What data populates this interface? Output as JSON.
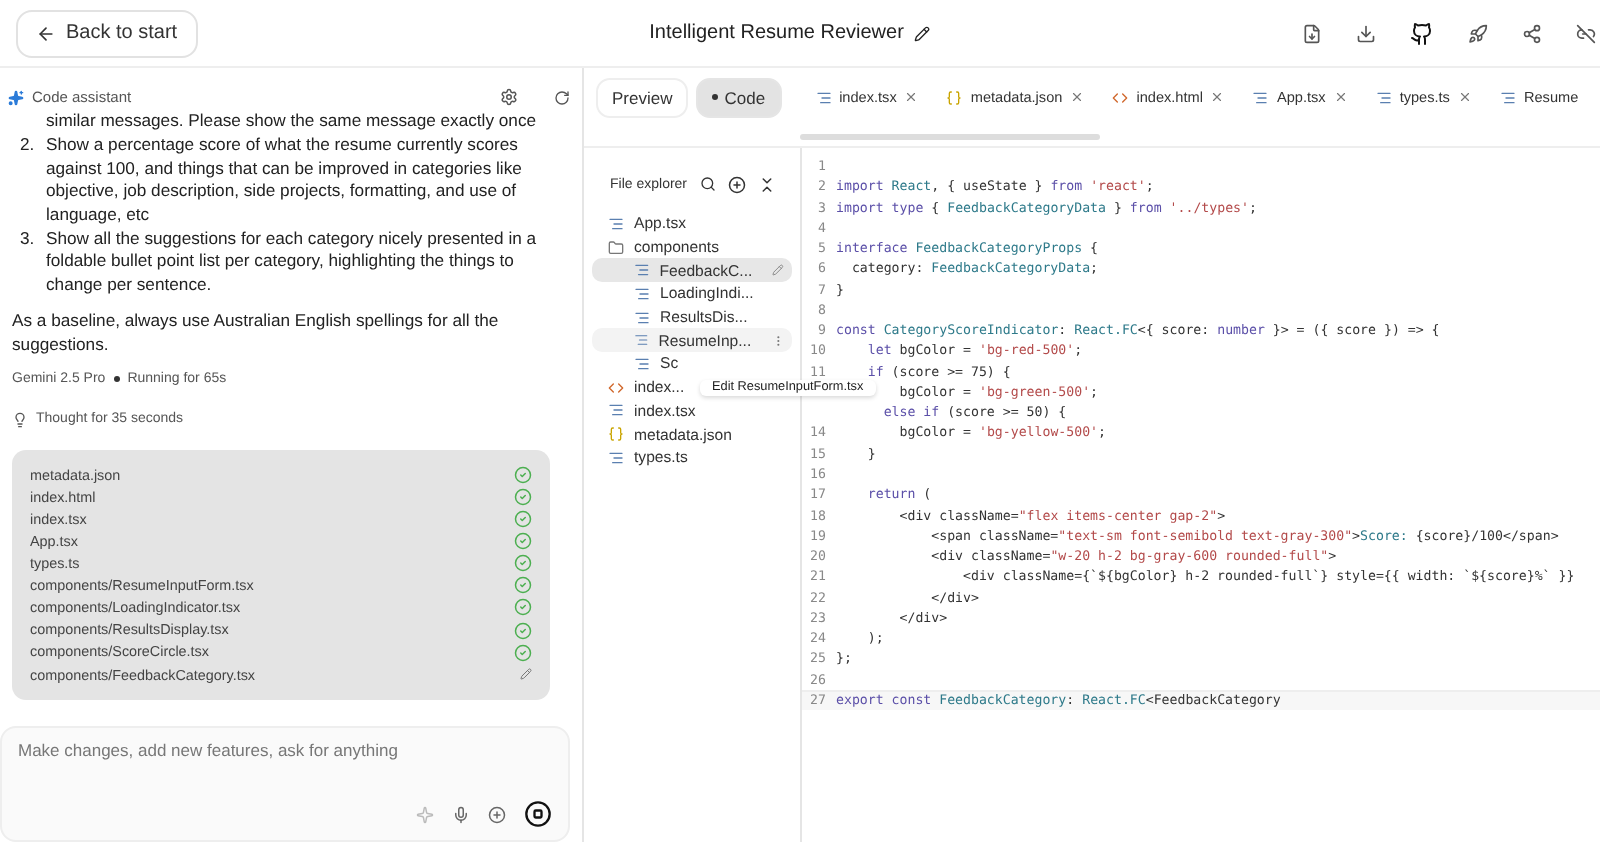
{
  "header": {
    "back_button": "Back to start",
    "title": "Intelligent Resume Reviewer"
  },
  "assistant": {
    "title": "Code assistant",
    "list_tail": "similar messages. Please show the same message exactly once",
    "list": [
      {
        "number": "2.",
        "text": "Show a percentage score of what the resume currently scores against 100, and things that can be improved in categories like objective, job description, side projects, formatting, and use of language, etc"
      },
      {
        "number": "3.",
        "text": "Show all the suggestions for each category nicely presented in a foldable bullet point list per category, highlighting the things to change per sentence."
      }
    ],
    "paragraph": "As a baseline, always use Australian English spellings for all the suggestions.",
    "model": "Gemini 2.5 Pro",
    "run_status": "Running for 65s",
    "thought": "Thought for 35 seconds",
    "files": [
      {
        "name": "metadata.json",
        "done": true
      },
      {
        "name": "index.html",
        "done": true
      },
      {
        "name": "index.tsx",
        "done": true
      },
      {
        "name": "App.tsx",
        "done": true
      },
      {
        "name": "types.ts",
        "done": true
      },
      {
        "name": "components/ResumeInputForm.tsx",
        "done": true
      },
      {
        "name": "components/LoadingIndicator.tsx",
        "done": true
      },
      {
        "name": "components/ResultsDisplay.tsx",
        "done": true
      },
      {
        "name": "components/ScoreCircle.tsx",
        "done": true
      },
      {
        "name": "components/FeedbackCategory.tsx",
        "done": false
      }
    ],
    "input": {
      "placeholder": "Make changes, add new features, ask for anything"
    }
  },
  "view_toggle": [
    {
      "label": "Preview",
      "selected": false
    },
    {
      "label": "Code",
      "selected": true
    }
  ],
  "file_tabs": [
    {
      "label": "index.tsx",
      "kind": "code",
      "closable": true
    },
    {
      "label": "metadata.json",
      "kind": "json",
      "closable": true
    },
    {
      "label": "index.html",
      "kind": "html",
      "closable": true
    },
    {
      "label": "App.tsx",
      "kind": "code",
      "closable": true
    },
    {
      "label": "types.ts",
      "kind": "code",
      "closable": true
    },
    {
      "label": "Resume",
      "kind": "code",
      "closable": false
    }
  ],
  "explorer": {
    "title": "File explorer",
    "tree": [
      {
        "label": "App.tsx",
        "kind": "code"
      },
      {
        "label": "components",
        "kind": "folder",
        "children": [
          {
            "label": "FeedbackC...",
            "kind": "code",
            "selected": true,
            "editing": true
          },
          {
            "label": "LoadingIndi...",
            "kind": "code",
            "selected": false
          },
          {
            "label": "ResultsDis...",
            "kind": "code",
            "selected": false
          },
          {
            "label": "ResumeInp...",
            "kind": "code",
            "selected": false,
            "hovered": true
          },
          {
            "label": "Sc",
            "kind": "code",
            "selected": false
          }
        ]
      },
      {
        "label": "index...",
        "kind": "html"
      },
      {
        "label": "index.tsx",
        "kind": "code"
      },
      {
        "label": "metadata.json",
        "kind": "json"
      },
      {
        "label": "types.ts",
        "kind": "code"
      }
    ],
    "tooltip": "Edit ResumeInputForm.tsx"
  },
  "editor": {
    "lines": [
      {
        "n": "1"
      },
      {
        "n": "2",
        "tokens": [
          {
            "kind": "kw",
            "t": "import "
          },
          {
            "kind": "type",
            "t": "React"
          },
          {
            "kind": "p",
            "t": ", { useState } "
          },
          {
            "kind": "kw",
            "t": "from "
          },
          {
            "kind": "str",
            "t": "'react'"
          },
          {
            "kind": "p",
            "t": ";"
          }
        ]
      },
      {
        "n": "3",
        "tokens": [
          {
            "kind": "kw",
            "t": "import type "
          },
          {
            "kind": "p",
            "t": "{ "
          },
          {
            "kind": "type",
            "t": "FeedbackCategoryData"
          },
          {
            "kind": "p",
            "t": " } "
          },
          {
            "kind": "kw",
            "t": "from "
          },
          {
            "kind": "str",
            "t": "'../types'"
          },
          {
            "kind": "p",
            "t": ";"
          }
        ]
      },
      {
        "n": "4"
      },
      {
        "n": "5",
        "tokens": [
          {
            "kind": "kw",
            "t": "interface "
          },
          {
            "kind": "type",
            "t": "FeedbackCategoryProps"
          },
          {
            "kind": "p",
            "t": " {"
          }
        ]
      },
      {
        "n": "6",
        "tokens": [
          {
            "kind": "p",
            "t": "  category: "
          },
          {
            "kind": "type",
            "t": "FeedbackCategoryData"
          },
          {
            "kind": "p",
            "t": ";"
          }
        ]
      },
      {
        "n": "7",
        "tokens": [
          {
            "kind": "p",
            "t": "}"
          }
        ]
      },
      {
        "n": "8"
      },
      {
        "n": "9",
        "tokens": [
          {
            "kind": "kw",
            "t": "const "
          },
          {
            "kind": "type",
            "t": "CategoryScoreIndicator"
          },
          {
            "kind": "p",
            "t": ": "
          },
          {
            "kind": "type",
            "t": "React.FC"
          },
          {
            "kind": "p",
            "t": "<{ score: "
          },
          {
            "kind": "kw",
            "t": "number"
          },
          {
            "kind": "p",
            "t": " }> = ({ score }) => {"
          }
        ]
      },
      {
        "n": "10",
        "tokens": [
          {
            "kind": "kw",
            "t": "    let "
          },
          {
            "kind": "p",
            "t": "bgColor = "
          },
          {
            "kind": "str",
            "t": "'bg-red-500'"
          },
          {
            "kind": "p",
            "t": ";"
          }
        ]
      },
      {
        "n": "11",
        "tokens": [
          {
            "kind": "kw",
            "t": "    if "
          },
          {
            "kind": "p",
            "t": "(score >= 75) {"
          }
        ]
      },
      {
        "tokens": [
          {
            "kind": "p",
            "t": "        bgColor = "
          },
          {
            "kind": "str",
            "t": "'bg-green-500'"
          },
          {
            "kind": "p",
            "t": ";"
          }
        ]
      },
      {
        "tokens": [
          {
            "kind": "kw",
            "t": "      else if "
          },
          {
            "kind": "p",
            "t": "(score >= 50) {"
          }
        ]
      },
      {
        "n": "14",
        "tokens": [
          {
            "kind": "p",
            "t": "        bgColor = "
          },
          {
            "kind": "str",
            "t": "'bg-yellow-500'"
          },
          {
            "kind": "p",
            "t": ";"
          }
        ]
      },
      {
        "n": "15",
        "tokens": [
          {
            "kind": "p",
            "t": "    }"
          }
        ]
      },
      {
        "n": "16"
      },
      {
        "n": "17",
        "tokens": [
          {
            "kind": "kw",
            "t": "    return "
          },
          {
            "kind": "p",
            "t": "("
          }
        ]
      },
      {
        "n": "18",
        "tokens": [
          {
            "kind": "p",
            "t": "        <div className="
          },
          {
            "kind": "str",
            "t": "\"flex items-center gap-2\""
          },
          {
            "kind": "p",
            "t": ">"
          }
        ]
      },
      {
        "n": "19",
        "tokens": [
          {
            "kind": "p",
            "t": "            <span className="
          },
          {
            "kind": "str",
            "t": "\"text-sm font-semibold text-gray-300\""
          },
          {
            "kind": "p",
            "t": ">"
          },
          {
            "kind": "type",
            "t": "Score: "
          },
          {
            "kind": "p",
            "t": "{score}/100</span>"
          }
        ]
      },
      {
        "n": "20",
        "tokens": [
          {
            "kind": "p",
            "t": "            <div className="
          },
          {
            "kind": "str",
            "t": "\"w-20 h-2 bg-gray-600 rounded-full\""
          },
          {
            "kind": "p",
            "t": ">"
          }
        ]
      },
      {
        "n": "21",
        "tokens": [
          {
            "kind": "p",
            "t": "                <div className={`${bgColor} h-2 rounded-full`} style={{ width: `${score}%` }}"
          }
        ]
      },
      {
        "n": "22",
        "tokens": [
          {
            "kind": "p",
            "t": "            </div>"
          }
        ]
      },
      {
        "n": "23",
        "tokens": [
          {
            "kind": "p",
            "t": "        </div>"
          }
        ]
      },
      {
        "n": "24",
        "tokens": [
          {
            "kind": "p",
            "t": "    );"
          }
        ]
      },
      {
        "n": "25",
        "tokens": [
          {
            "kind": "p",
            "t": "};"
          }
        ]
      },
      {
        "n": "26"
      },
      {
        "n": "27",
        "current": true,
        "tokens": [
          {
            "kind": "kw",
            "t": "export const "
          },
          {
            "kind": "type",
            "t": "FeedbackCategory"
          },
          {
            "kind": "p",
            "t": ": "
          },
          {
            "kind": "type",
            "t": "React.FC"
          },
          {
            "kind": "p",
            "t": "<FeedbackCategory"
          }
        ]
      }
    ]
  }
}
